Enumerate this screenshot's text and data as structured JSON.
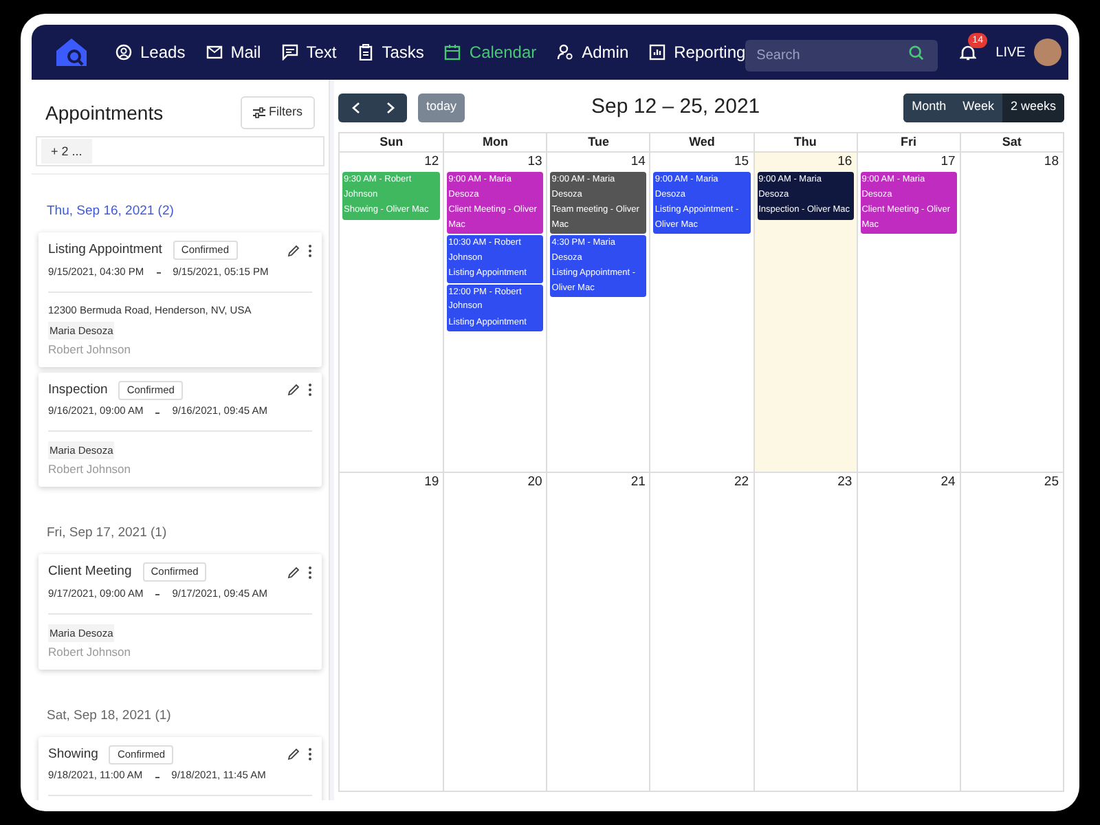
{
  "nav": {
    "items": [
      {
        "label": "Leads",
        "selected": false
      },
      {
        "label": "Mail",
        "selected": false
      },
      {
        "label": "Text",
        "selected": false
      },
      {
        "label": "Tasks",
        "selected": false
      },
      {
        "label": "Calendar",
        "selected": true
      },
      {
        "label": "Admin",
        "selected": false
      },
      {
        "label": "Reporting",
        "selected": false
      }
    ],
    "search": {
      "placeholder": "Search"
    },
    "notifications": "14",
    "live": "LIVE"
  },
  "sidebar": {
    "title": "Appointments",
    "filters": "Filters",
    "chip": "+ 2 ...",
    "groups": [
      {
        "heading": "Thu, Sep 16, 2021 (2)",
        "selected": true,
        "cards": [
          {
            "title": "Listing Appointment",
            "status": "Confirmed",
            "start": "9/15/2021, 04:30 PM",
            "end": "9/15/2021, 05:15 PM",
            "address": "12300 Bermuda Road, Henderson, NV, USA",
            "agent": "Maria Desoza",
            "client": "Robert Johnson"
          },
          {
            "title": "Inspection",
            "status": "Confirmed",
            "start": "9/16/2021, 09:00 AM",
            "end": "9/16/2021, 09:45 AM",
            "agent": "Maria Desoza",
            "client": "Robert Johnson"
          }
        ]
      },
      {
        "heading": "Fri, Sep 17, 2021 (1)",
        "selected": false,
        "cards": [
          {
            "title": "Client Meeting",
            "status": "Confirmed",
            "start": "9/17/2021, 09:00 AM",
            "end": "9/17/2021, 09:45 AM",
            "agent": "Maria Desoza",
            "client": "Robert Johnson"
          }
        ]
      },
      {
        "heading": "Sat, Sep 18, 2021 (1)",
        "selected": false,
        "cards": [
          {
            "title": "Showing",
            "status": "Confirmed",
            "start": "9/18/2021, 11:00 AM",
            "end": "9/18/2021, 11:45 AM"
          }
        ]
      }
    ]
  },
  "calendar": {
    "today": "today",
    "title": "Sep 12 – 25, 2021",
    "views": [
      {
        "label": "Month",
        "selected": false
      },
      {
        "label": "Week",
        "selected": false
      },
      {
        "label": "2 weeks",
        "selected": true
      }
    ],
    "weekdays": [
      "Sun",
      "Mon",
      "Tue",
      "Wed",
      "Thu",
      "Fri",
      "Sat"
    ],
    "weeks": [
      [
        {
          "date": "12",
          "today": false,
          "events": [
            {
              "time": "9:30 AM - Robert Johnson",
              "title": "Showing - Oliver Mac",
              "color": "#3fb860"
            }
          ]
        },
        {
          "date": "13",
          "today": false,
          "events": [
            {
              "time": "9:00 AM - Maria Desoza",
              "title": "Client Meeting - Oliver Mac",
              "color": "#c02cc0"
            },
            {
              "time": "10:30 AM - Robert Johnson",
              "title": "Listing Appointment",
              "color": "#2f4df0"
            },
            {
              "time": "12:00 PM - Robert Johnson",
              "title": "Listing Appointment",
              "color": "#2f4df0"
            }
          ]
        },
        {
          "date": "14",
          "today": false,
          "events": [
            {
              "time": "9:00 AM - Maria Desoza",
              "title": "Team meeting - Oliver Mac",
              "color": "#555555"
            },
            {
              "time": "4:30 PM - Maria Desoza",
              "title": "Listing Appointment - Oliver Mac",
              "color": "#2f4df0"
            }
          ]
        },
        {
          "date": "15",
          "today": false,
          "events": [
            {
              "time": "9:00 AM - Maria Desoza",
              "title": "Listing Appointment - Oliver Mac",
              "color": "#2f4df0"
            }
          ]
        },
        {
          "date": "16",
          "today": true,
          "events": [
            {
              "time": "9:00 AM - Maria Desoza",
              "title": "Inspection - Oliver Mac",
              "color": "#101840"
            }
          ]
        },
        {
          "date": "17",
          "today": false,
          "events": [
            {
              "time": "9:00 AM - Maria Desoza",
              "title": "Client Meeting - Oliver Mac",
              "color": "#c02cc0"
            }
          ]
        },
        {
          "date": "18",
          "today": false
        }
      ],
      [
        {
          "date": "19",
          "today": false
        },
        {
          "date": "20",
          "today": false
        },
        {
          "date": "21",
          "today": false
        },
        {
          "date": "22",
          "today": false
        },
        {
          "date": "23",
          "today": false
        },
        {
          "date": "24",
          "today": false
        },
        {
          "date": "25",
          "today": false
        }
      ]
    ]
  }
}
